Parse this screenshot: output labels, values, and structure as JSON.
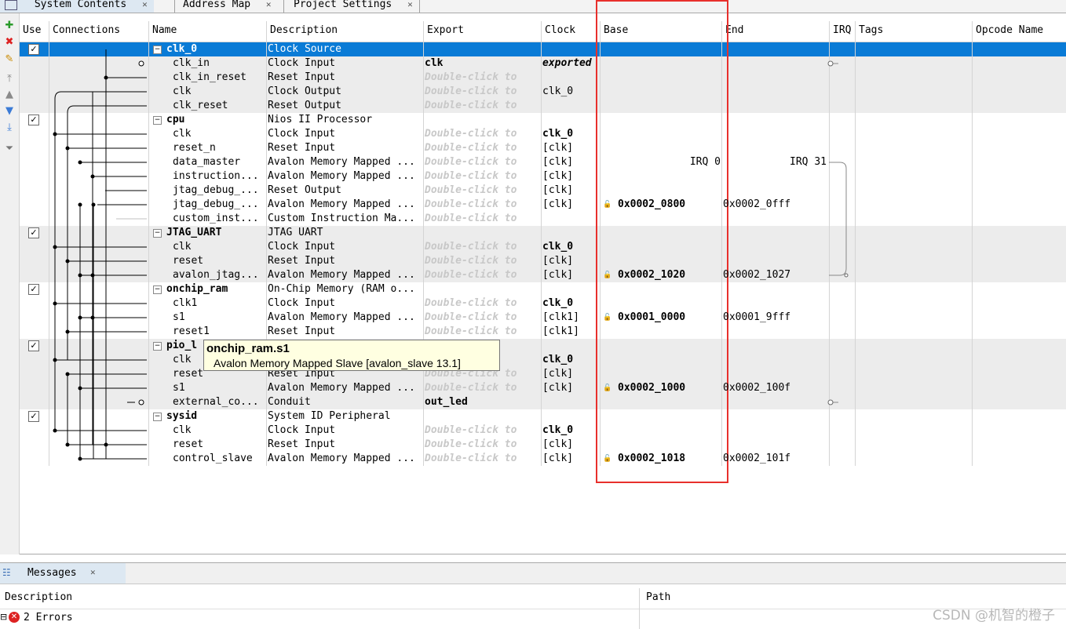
{
  "tabs": [
    {
      "label": "System Contents",
      "active": true
    },
    {
      "label": "Address Map",
      "active": false
    },
    {
      "label": "Project Settings",
      "active": false
    }
  ],
  "toolbar": {
    "icons": [
      "add-icon",
      "remove-icon",
      "edit-icon",
      "move-top-icon",
      "move-up-icon",
      "move-down-icon",
      "move-bottom-icon",
      "filter-icon"
    ]
  },
  "columns": [
    "Use",
    "Connections",
    "Name",
    "Description",
    "Export",
    "Clock",
    "Base",
    "End",
    "IRQ",
    "Tags",
    "Opcode Name"
  ],
  "rows": [
    {
      "kind": "module",
      "name": "clk_0",
      "desc": "Clock Source",
      "export": "",
      "clock": "",
      "base": "",
      "end": "",
      "checked": true,
      "selected": true
    },
    {
      "kind": "port",
      "name": "clk_in",
      "desc": "Clock Input",
      "export": "clk",
      "export_style": "bold",
      "clock": "exported",
      "clock_style": "bolditalic",
      "base": "",
      "end": ""
    },
    {
      "kind": "port",
      "name": "clk_in_reset",
      "desc": "Reset Input",
      "export": "Double-click to",
      "export_style": "dbl",
      "clock": "",
      "base": "",
      "end": ""
    },
    {
      "kind": "port",
      "name": "clk",
      "desc": "Clock Output",
      "export": "Double-click to",
      "export_style": "dbl",
      "clock": "clk_0",
      "base": "",
      "end": ""
    },
    {
      "kind": "port",
      "name": "clk_reset",
      "desc": "Reset Output",
      "export": "Double-click to",
      "export_style": "dbl",
      "clock": "",
      "base": "",
      "end": ""
    },
    {
      "kind": "module",
      "name": "cpu",
      "desc": "Nios II Processor",
      "export": "",
      "clock": "",
      "base": "",
      "end": "",
      "checked": true
    },
    {
      "kind": "port",
      "name": "clk",
      "desc": "Clock Input",
      "export": "Double-click to",
      "export_style": "dbl",
      "clock": "clk_0",
      "clock_style": "bold",
      "base": "",
      "end": ""
    },
    {
      "kind": "port",
      "name": "reset_n",
      "desc": "Reset Input",
      "export": "Double-click to",
      "export_style": "dbl",
      "clock": "[clk]",
      "base": "",
      "end": ""
    },
    {
      "kind": "port",
      "name": "data_master",
      "desc": "Avalon Memory Mapped ...",
      "export": "Double-click to",
      "export_style": "dbl",
      "clock": "[clk]",
      "base": "IRQ 0",
      "end": "IRQ 31",
      "irqlabel": true
    },
    {
      "kind": "port",
      "name": "instruction...",
      "desc": "Avalon Memory Mapped ...",
      "export": "Double-click to",
      "export_style": "dbl",
      "clock": "[clk]",
      "base": "",
      "end": ""
    },
    {
      "kind": "port",
      "name": "jtag_debug_...",
      "desc": "Reset Output",
      "export": "Double-click to",
      "export_style": "dbl",
      "clock": "[clk]",
      "base": "",
      "end": ""
    },
    {
      "kind": "port",
      "name": "jtag_debug_...",
      "desc": "Avalon Memory Mapped ...",
      "export": "Double-click to",
      "export_style": "dbl",
      "clock": "[clk]",
      "base": "0x0002_0800",
      "end": "0x0002_0fff"
    },
    {
      "kind": "port",
      "name": "custom_inst...",
      "desc": "Custom Instruction Ma...",
      "export": "Double-click to",
      "export_style": "dbl",
      "clock": "",
      "base": "",
      "end": ""
    },
    {
      "kind": "module",
      "name": "JTAG_UART",
      "desc": "JTAG UART",
      "export": "",
      "clock": "",
      "base": "",
      "end": "",
      "checked": true
    },
    {
      "kind": "port",
      "name": "clk",
      "desc": "Clock Input",
      "export": "Double-click to",
      "export_style": "dbl",
      "clock": "clk_0",
      "clock_style": "bold",
      "base": "",
      "end": ""
    },
    {
      "kind": "port",
      "name": "reset",
      "desc": "Reset Input",
      "export": "Double-click to",
      "export_style": "dbl",
      "clock": "[clk]",
      "base": "",
      "end": ""
    },
    {
      "kind": "port",
      "name": "avalon_jtag...",
      "desc": "Avalon Memory Mapped ...",
      "export": "Double-click to",
      "export_style": "dbl",
      "clock": "[clk]",
      "base": "0x0002_1020",
      "end": "0x0002_1027"
    },
    {
      "kind": "module",
      "name": "onchip_ram",
      "desc": "On-Chip Memory (RAM o...",
      "export": "",
      "clock": "",
      "base": "",
      "end": "",
      "checked": true
    },
    {
      "kind": "port",
      "name": "clk1",
      "desc": "Clock Input",
      "export": "Double-click to",
      "export_style": "dbl",
      "clock": "clk_0",
      "clock_style": "bold",
      "base": "",
      "end": ""
    },
    {
      "kind": "port",
      "name": "s1",
      "desc": "Avalon Memory Mapped ...",
      "export": "Double-click to",
      "export_style": "dbl",
      "clock": "[clk1]",
      "base": "0x0001_0000",
      "end": "0x0001_9fff"
    },
    {
      "kind": "port",
      "name": "reset1",
      "desc": "Reset Input",
      "export": "Double-click to",
      "export_style": "dbl",
      "clock": "[clk1]",
      "base": "",
      "end": ""
    },
    {
      "kind": "module",
      "name": "pio_l",
      "desc": "",
      "export": "",
      "clock": "",
      "base": "",
      "end": "",
      "checked": true
    },
    {
      "kind": "port",
      "name": "clk",
      "desc": "",
      "export": "",
      "export_style": "dbl",
      "clock": "clk_0",
      "clock_style": "bold",
      "base": "",
      "end": ""
    },
    {
      "kind": "port",
      "name": "reset",
      "desc": "Reset Input",
      "export": "Double-click to",
      "export_style": "dbl",
      "clock": "[clk]",
      "base": "",
      "end": ""
    },
    {
      "kind": "port",
      "name": "s1",
      "desc": "Avalon Memory Mapped ...",
      "export": "Double-click to",
      "export_style": "dbl",
      "clock": "[clk]",
      "base": "0x0002_1000",
      "end": "0x0002_100f"
    },
    {
      "kind": "port",
      "name": "external_co...",
      "desc": "Conduit",
      "export": "out_led",
      "export_style": "bold",
      "clock": "",
      "base": "",
      "end": ""
    },
    {
      "kind": "module",
      "name": "sysid",
      "desc": "System ID Peripheral",
      "export": "",
      "clock": "",
      "base": "",
      "end": "",
      "checked": true
    },
    {
      "kind": "port",
      "name": "clk",
      "desc": "Clock Input",
      "export": "Double-click to",
      "export_style": "dbl",
      "clock": "clk_0",
      "clock_style": "bold",
      "base": "",
      "end": ""
    },
    {
      "kind": "port",
      "name": "reset",
      "desc": "Reset Input",
      "export": "Double-click to",
      "export_style": "dbl",
      "clock": "[clk]",
      "base": "",
      "end": ""
    },
    {
      "kind": "port",
      "name": "control_slave",
      "desc": "Avalon Memory Mapped ...",
      "export": "Double-click to",
      "export_style": "dbl",
      "clock": "[clk]",
      "base": "0x0002_1018",
      "end": "0x0002_101f"
    }
  ],
  "tooltip": {
    "title": "onchip_ram.s1",
    "body": "Avalon Memory Mapped Slave [avalon_slave 13.1]"
  },
  "messages": {
    "tab": "Messages",
    "col_description": "Description",
    "col_path": "Path",
    "summary": "2 Errors"
  },
  "watermark": "CSDN @机智的橙子",
  "colors": {
    "selection": "#0a7bd6",
    "highlight_box": "#e8302c",
    "band": "#ececec",
    "tooltip_bg": "#ffffe1"
  }
}
